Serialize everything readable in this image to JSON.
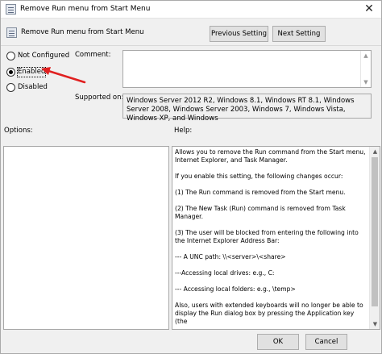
{
  "window": {
    "title": "Remove Run menu from Start Menu",
    "close_glyph": "✕"
  },
  "header": {
    "setting_name": "Remove Run menu from Start Menu",
    "previous_label": "Previous Setting",
    "next_label": "Next Setting"
  },
  "state": {
    "not_configured": "Not Configured",
    "enabled": "Enabled",
    "disabled": "Disabled",
    "selected": "Enabled"
  },
  "comment": {
    "label": "Comment:",
    "value": ""
  },
  "supported": {
    "label": "Supported on:",
    "value": "Windows Server 2012 R2, Windows 8.1, Windows RT 8.1, Windows Server 2008, Windows Server 2003, Windows 7, Windows Vista, Windows XP, and Windows"
  },
  "options": {
    "label": "Options:"
  },
  "help": {
    "label": "Help:",
    "paragraphs": [
      "Allows you to remove the Run command from the Start menu, Internet Explorer, and Task Manager.",
      "If you enable this setting, the following changes occur:",
      "(1) The Run command is removed from the Start menu.",
      "(2) The New Task (Run) command is removed from Task Manager.",
      "(3) The user will be blocked from entering the following into the Internet Explorer Address Bar:",
      "--- A UNC path: \\\\<server>\\<share>",
      "---Accessing local drives:  e.g., C:",
      "--- Accessing local folders: e.g., \\temp>",
      "Also, users with extended keyboards will no longer be able to display the Run dialog box by pressing the Application key (the"
    ]
  },
  "footer": {
    "ok_label": "OK",
    "cancel_label": "Cancel"
  },
  "icons": {
    "scroll_up": "▲",
    "scroll_down": "▼"
  },
  "colors": {
    "annotation_arrow": "#e02020"
  }
}
